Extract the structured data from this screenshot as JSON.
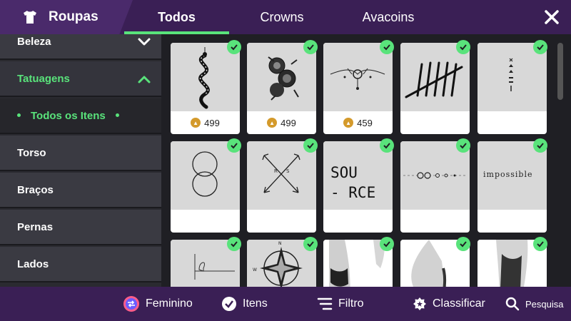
{
  "header": {
    "brand_icon": "shirt-icon",
    "title": "Roupas",
    "tabs": [
      {
        "label": "Todos",
        "active": true
      },
      {
        "label": "Crowns",
        "active": false
      },
      {
        "label": "Avacoins",
        "active": false
      }
    ],
    "close_icon": "close-icon"
  },
  "sidebar": {
    "items": [
      {
        "label": "Beleza",
        "kind": "category",
        "state": "collapsed"
      },
      {
        "label": "Tatuagens",
        "kind": "category",
        "state": "expanded"
      },
      {
        "label": "Todos os Itens",
        "kind": "subcategory",
        "selected": true
      },
      {
        "label": "Torso",
        "kind": "subcategory"
      },
      {
        "label": "Braços",
        "kind": "subcategory"
      },
      {
        "label": "Pernas",
        "kind": "subcategory"
      },
      {
        "label": "Lados",
        "kind": "subcategory"
      }
    ]
  },
  "grid": {
    "items": [
      {
        "art": "snake-tattoo",
        "price": "499",
        "owned": true
      },
      {
        "art": "roses-tattoo",
        "price": "499",
        "owned": true
      },
      {
        "art": "ornament-tattoo",
        "price": "459",
        "owned": true
      },
      {
        "art": "tally-marks-tattoo",
        "price": "",
        "owned": true
      },
      {
        "art": "small-symbols-tattoo",
        "price": "",
        "owned": true
      },
      {
        "art": "circles-tattoo",
        "price": "",
        "owned": true
      },
      {
        "art": "arrows-tattoo",
        "price": "",
        "owned": true
      },
      {
        "art": "source-text-tattoo",
        "price": "",
        "owned": true,
        "text_line1": "SOU",
        "text_line2": "- RCE"
      },
      {
        "art": "dotline-tattoo",
        "price": "",
        "owned": true
      },
      {
        "art": "impossible-text-tattoo",
        "price": "",
        "owned": true,
        "text": "impossible"
      },
      {
        "art": "bird-line-tattoo",
        "price": "",
        "owned": true
      },
      {
        "art": "compass-tattoo",
        "price": "",
        "owned": true
      },
      {
        "art": "thigh-lace-tattoo",
        "price": "",
        "owned": true
      },
      {
        "art": "hip-tattoo",
        "price": "",
        "owned": true
      },
      {
        "art": "arm-tattoo",
        "price": "",
        "owned": true
      }
    ]
  },
  "bottombar": {
    "gender_label": "Feminino",
    "items_label": "Itens",
    "filter_label": "Filtro",
    "sort_label": "Classificar",
    "search_label": "Pesquisa"
  },
  "colors": {
    "accent": "#59e37b",
    "bar": "#3a1f55",
    "brand": "#4a2a6b",
    "coin": "#d49a2b"
  }
}
